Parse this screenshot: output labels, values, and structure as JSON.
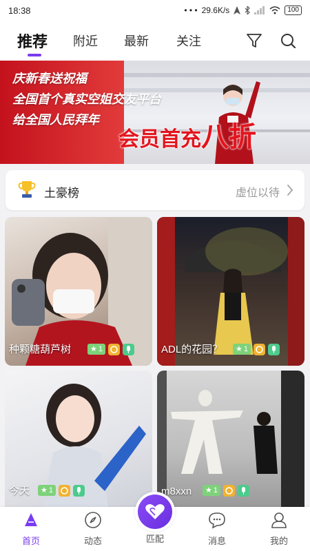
{
  "status_bar": {
    "time": "18:38",
    "network": "29.6K/s",
    "battery": "100"
  },
  "tabs": [
    {
      "label": "推荐",
      "active": true
    },
    {
      "label": "附近",
      "active": false
    },
    {
      "label": "最新",
      "active": false
    },
    {
      "label": "关注",
      "active": false
    }
  ],
  "header_icons": [
    "filter-icon",
    "search-icon"
  ],
  "banner": {
    "lines": [
      "庆新春送祝福",
      "全国首个真实空姐交友平台",
      "给全国人民拜年"
    ],
    "promo_main": "会员首充",
    "promo_emph": "八折"
  },
  "ranking": {
    "title": "土豪榜",
    "status": "虚位以待"
  },
  "cards": [
    {
      "name": "种颗糖葫芦树",
      "level": "1"
    },
    {
      "name": "ADL的花园？",
      "level": "1"
    },
    {
      "name": "今天",
      "level": "1"
    },
    {
      "name": "m8xxn",
      "level": "1"
    }
  ],
  "bottom_nav": [
    {
      "label": "首页",
      "icon": "home-icon",
      "active": true
    },
    {
      "label": "动态",
      "icon": "compass-icon",
      "active": false
    },
    {
      "label": "匹配",
      "icon": "heart-icon",
      "active": false
    },
    {
      "label": "消息",
      "icon": "message-icon",
      "active": false
    },
    {
      "label": "我的",
      "icon": "profile-icon",
      "active": false
    }
  ],
  "colors": {
    "accent": "#7a3cf0",
    "level_badge": "#7ed27a",
    "coin_badge": "#f0b330",
    "mic_badge": "#4ccb8c"
  }
}
